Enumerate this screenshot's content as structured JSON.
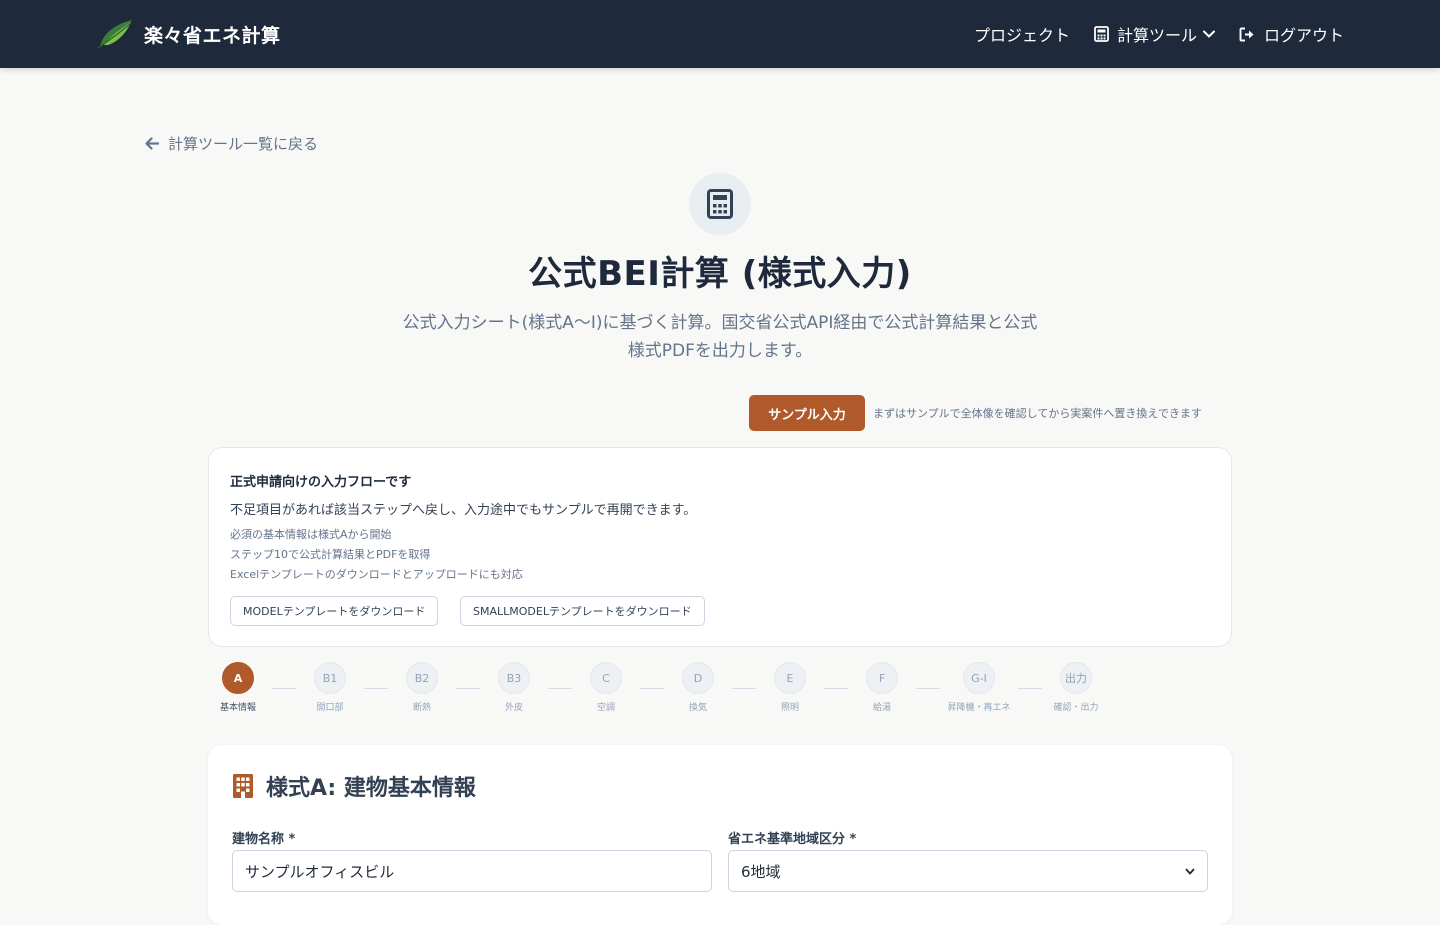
{
  "header": {
    "brand_name": "楽々省エネ計算",
    "logo_icon": "leaf-logo",
    "nav": {
      "projects_label": "プロジェクト",
      "tools_label": "計算ツール",
      "tools_icon": "calculator-icon",
      "logout_label": "ログアウト",
      "logout_icon": "sign-out-icon"
    }
  },
  "back_link": {
    "label": "計算ツール一覧に戻る",
    "icon": "arrow-left-icon"
  },
  "hero": {
    "icon": "calculator-icon",
    "title": "公式BEI計算 (様式入力)",
    "subtitle_line1": "公式入力シート(様式A〜I)に基づく計算。国交省公式API経由で公式計算結果と公式",
    "subtitle_line2": "様式PDFを出力します。"
  },
  "sample": {
    "button_label": "サンプル入力",
    "note": "まずはサンプルで全体像を確認してから実案件へ置き換えできます"
  },
  "info_card": {
    "title": "正式申請向けの入力フローです",
    "description": "不足項目があれば該当ステップへ戻し、入力途中でもサンプルで再開できます。",
    "bullets": [
      "必須の基本情報は様式Aから開始",
      "ステップ10で公式計算結果とPDFを取得",
      "Excelテンプレートのダウンロードとアップロードにも対応"
    ],
    "model_template_button": "MODELテンプレートをダウンロード",
    "smallmodel_template_button": "SMALLMODELテンプレートをダウンロード"
  },
  "steps": [
    {
      "code": "A",
      "label": "基本情報",
      "active": true
    },
    {
      "code": "B1",
      "label": "開口部",
      "active": false
    },
    {
      "code": "B2",
      "label": "断熱",
      "active": false
    },
    {
      "code": "B3",
      "label": "外皮",
      "active": false
    },
    {
      "code": "C",
      "label": "空調",
      "active": false
    },
    {
      "code": "D",
      "label": "換気",
      "active": false
    },
    {
      "code": "E",
      "label": "照明",
      "active": false
    },
    {
      "code": "F",
      "label": "給湯",
      "active": false
    },
    {
      "code": "G-I",
      "label": "昇降機・再エネ",
      "active": false
    },
    {
      "code": "出力",
      "label": "確認・出力",
      "active": false
    }
  ],
  "form": {
    "icon": "building-icon",
    "title": "様式A: 建物基本情報",
    "building_name_label": "建物名称 *",
    "building_name_value": "サンプルオフィスビル",
    "region_label": "省エネ基準地域区分 *",
    "region_value": "6地域"
  },
  "colors": {
    "header_bg": "#1e293b",
    "accent": "#b0592a",
    "page_bg": "#f8f8f7"
  }
}
